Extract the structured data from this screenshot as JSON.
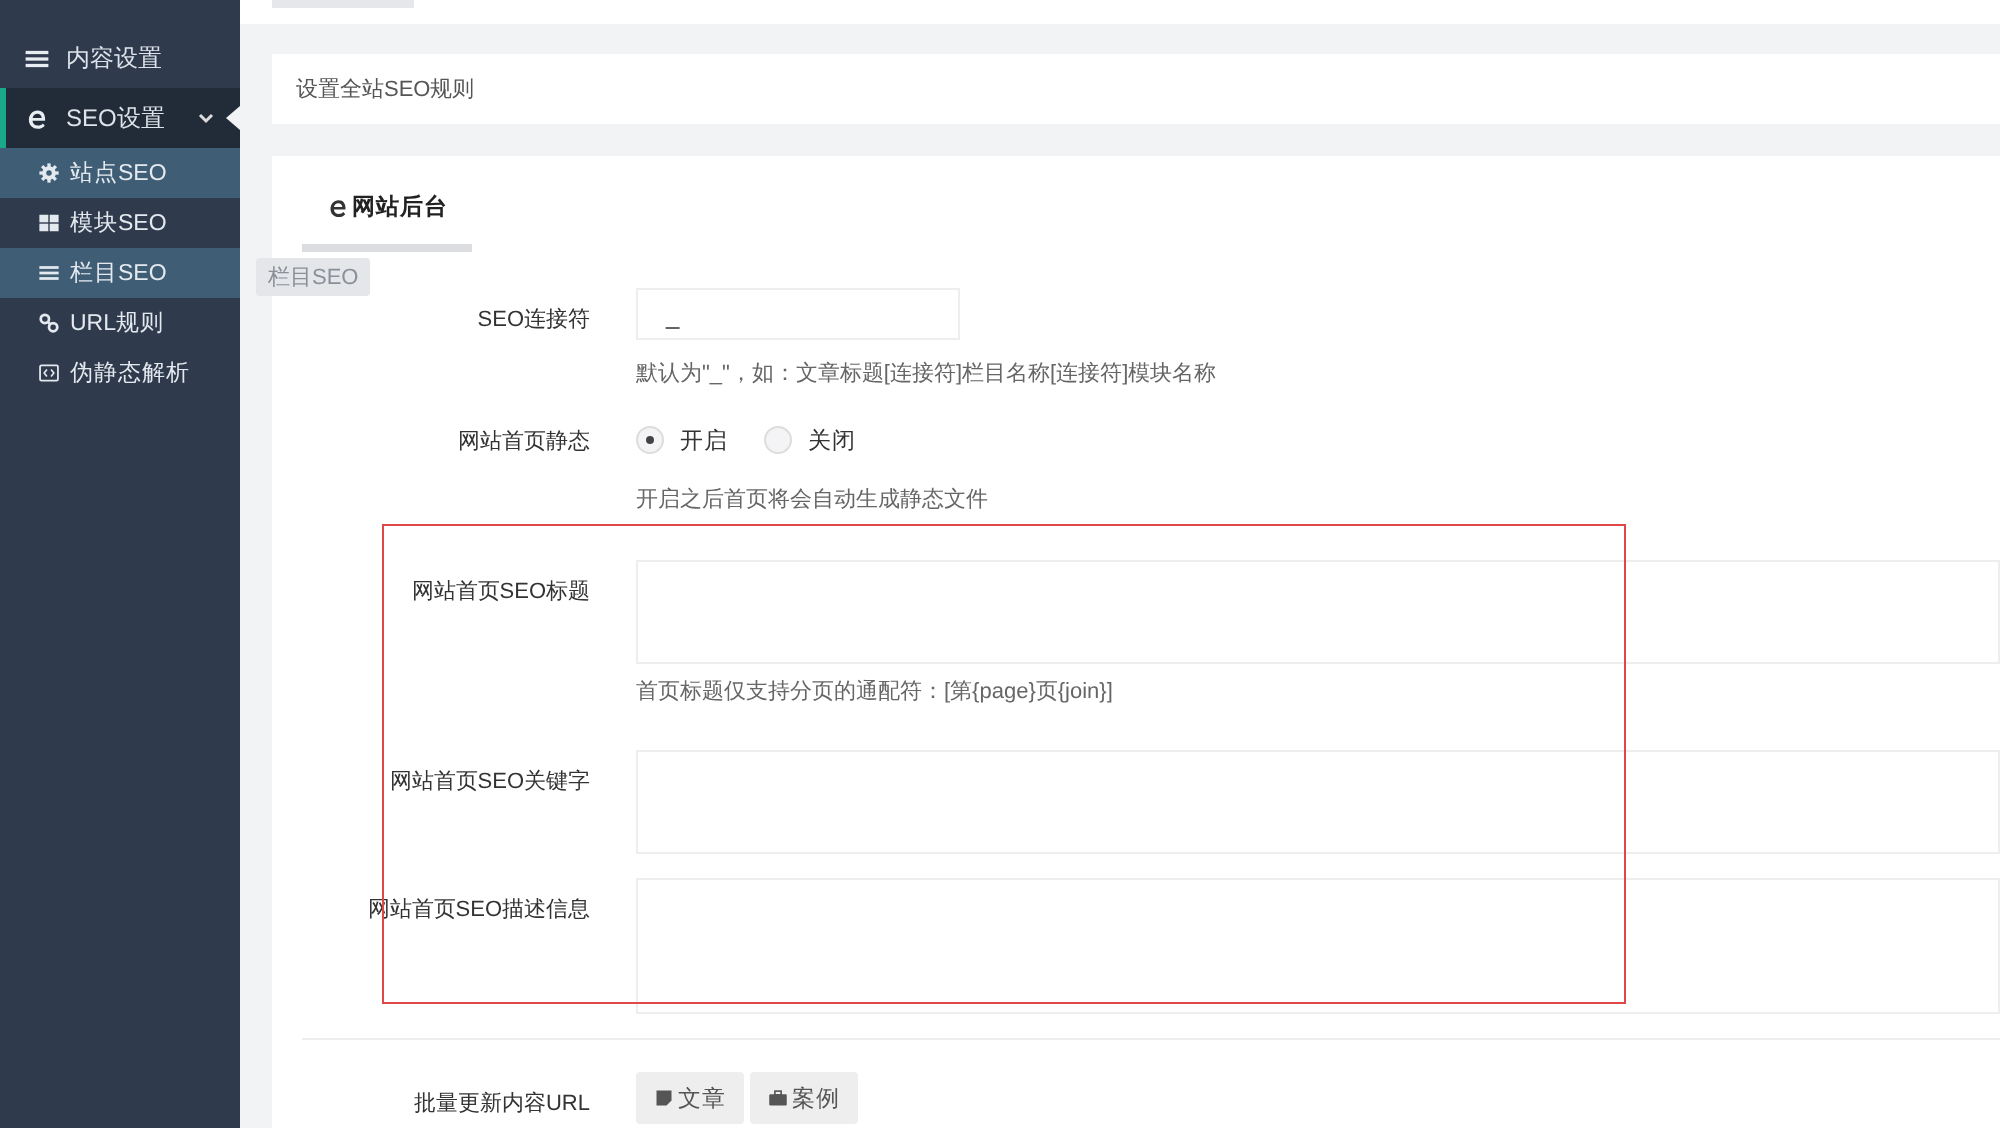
{
  "sidebar": {
    "items": [
      {
        "label": "内容设置",
        "selected": false,
        "expanded": false
      },
      {
        "label": "SEO设置",
        "selected": true,
        "expanded": true,
        "children": [
          {
            "label": "站点SEO",
            "selected": true
          },
          {
            "label": "模块SEO",
            "selected": false
          },
          {
            "label": "栏目SEO",
            "selected": true
          },
          {
            "label": "URL规则",
            "selected": false
          },
          {
            "label": "伪静态解析",
            "selected": false
          }
        ]
      }
    ]
  },
  "tooltip": "栏目SEO",
  "notice": "设置全站SEO规则",
  "tabs": [
    {
      "label": "网站后台",
      "selected": true
    }
  ],
  "form": [
    {
      "kind": "input",
      "label": "SEO连接符",
      "value": "_",
      "hint": "默认为\"_\"，如：文章标题[连接符]栏目名称[连接符]模块名称"
    },
    {
      "kind": "radio",
      "label": "网站首页静态",
      "options": [
        {
          "label": "开启",
          "selected": true
        },
        {
          "label": "关闭",
          "selected": false
        }
      ],
      "hint": "开启之后首页将会自动生成静态文件"
    },
    {
      "kind": "textarea",
      "label": "网站首页SEO标题",
      "hint": "首页标题仅支持分页的通配符：[第{page}页{join}]",
      "highlighted": true
    },
    {
      "kind": "textarea",
      "label": "网站首页SEO关键字",
      "highlighted": true
    },
    {
      "kind": "textarea",
      "label": "网站首页SEO描述信息",
      "highlighted": true
    },
    {
      "kind": "divider"
    },
    {
      "kind": "buttons",
      "label": "批量更新内容URL",
      "buttons": [
        {
          "label": "文章"
        },
        {
          "label": "案例"
        }
      ]
    }
  ]
}
